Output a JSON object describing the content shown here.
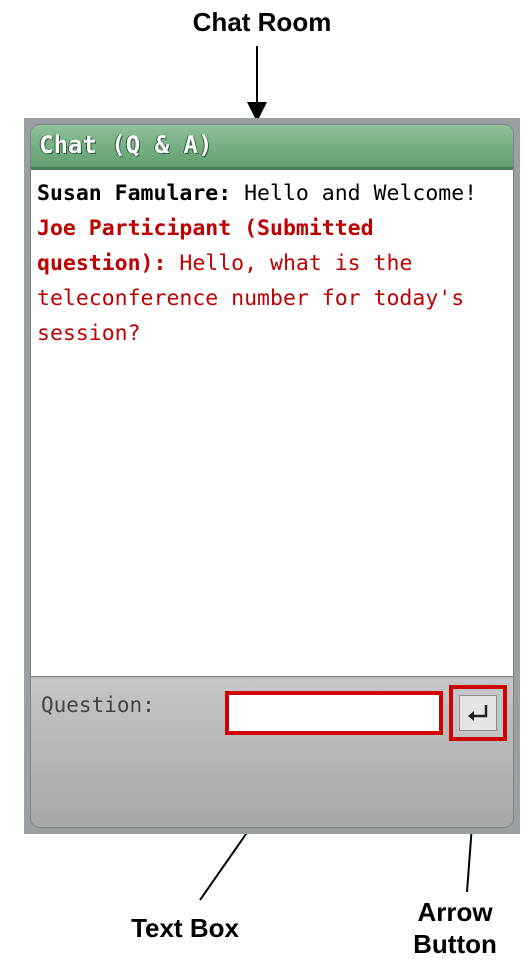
{
  "annotations": {
    "title": "Chat Room",
    "text_box": "Text Box",
    "arrow_button_line1": "Arrow",
    "arrow_button_line2": "Button"
  },
  "chat": {
    "header": "Chat (Q & A)",
    "messages": [
      {
        "sender": "Susan Famulare:",
        "text": " Hello and Welcome!",
        "role": "host"
      },
      {
        "sender": "Joe Participant (Submitted question):",
        "text": " Hello, what is the teleconference number for today's session?",
        "role": "participant"
      }
    ],
    "question_label": "Question:",
    "question_value": "",
    "send_icon": "enter-arrow-icon"
  },
  "colors": {
    "header_green": "#6aa67a",
    "participant_red": "#c00000",
    "highlight_red": "#d10000"
  }
}
